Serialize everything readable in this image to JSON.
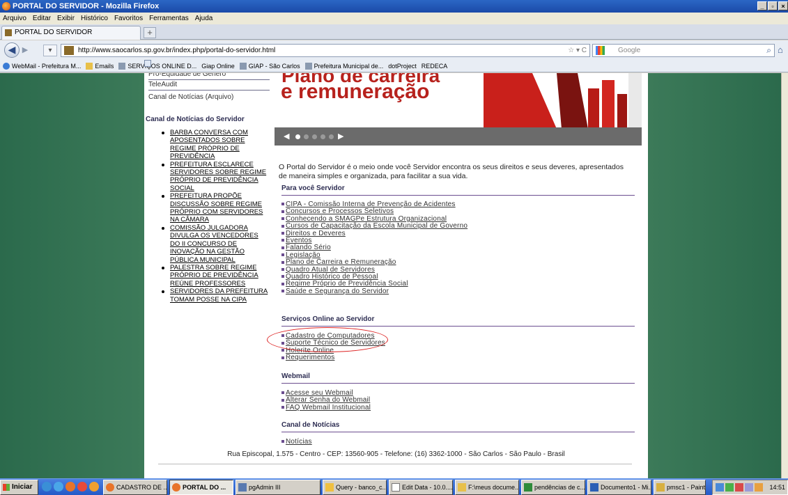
{
  "window": {
    "title": "PORTAL DO SERVIDOR - Mozilla Firefox",
    "min": "_",
    "max": "▫",
    "close": "×"
  },
  "menu": [
    "Arquivo",
    "Editar",
    "Exibir",
    "Histórico",
    "Favoritos",
    "Ferramentas",
    "Ajuda"
  ],
  "tab": {
    "label": "PORTAL DO SERVIDOR",
    "new": "+"
  },
  "nav": {
    "url": "http://www.saocarlos.sp.gov.br/index.php/portal-do-servidor.html",
    "url_ctrls": "☆ ▾ C",
    "search_placeholder": "Google"
  },
  "bookmarks": [
    {
      "label": "WebMail - Prefeitura M...",
      "icon": "globe-icon"
    },
    {
      "label": "Emails",
      "icon": "folder-icon"
    },
    {
      "label": "SERVIÇOS ONLINE D...",
      "icon": "site-icon"
    },
    {
      "label": "Giap Online",
      "icon": "page-icon"
    },
    {
      "label": "GIAP - São Carlos",
      "icon": "site-icon"
    },
    {
      "label": "Prefeitura Municipal de...",
      "icon": "site-icon"
    },
    {
      "label": "dotProject",
      "icon": "page-icon"
    },
    {
      "label": "REDECA",
      "icon": "page-icon"
    }
  ],
  "left": {
    "cut_link": "Pró-Equidade de Gênero",
    "top_links": [
      "TeleAudit",
      "Canal de Notícias (Arquivo)"
    ],
    "news_title": "Canal de Notícias do Servidor",
    "news": [
      "BARBA CONVERSA COM APOSENTADOS SOBRE REGIME PRÓPRIO DE PREVIDÊNCIA",
      "PREFEITURA ESCLARECE SERVIDORES SOBRE REGIME PRÓPRIO DE PREVIDÊNCIA SOCIAL",
      "PREFEITURA PROPÕE DISCUSSÃO SOBRE REGIME PRÓPRIO COM SERVIDORES NA CÂMARA",
      "COMISSÃO JULGADORA DIVULGA OS VENCEDORES DO II CONCURSO DE INOVAÇÃO NA GESTÃO PÚBLICA MUNICIPAL",
      "PALESTRA SOBRE REGIME PRÓPRIO DE PREVIDÊNCIA REÚNE PROFESSORES",
      "SERVIDORES DA PREFEITURA TOMAM POSSE NA CIPA"
    ]
  },
  "banner": {
    "line1": "Plano de carreira",
    "line2": "e remuneração",
    "prev": "◀",
    "next": "▶"
  },
  "intro": "O Portal do Servidor é o meio onde você Servidor encontra os seus direitos e seus deveres, apresentados de maneira simples e organizada, para facilitar a sua vida.",
  "sections": [
    {
      "title": "Para você Servidor",
      "links": [
        "CIPA - Comissão Interna de Prevenção de Acidentes",
        "Concursos e Processos Seletivos",
        "Conhecendo a SMAGPe Estrutura Organizacional",
        "Cursos de Capacitação da Escola Municipal de Governo",
        "Direitos e Deveres",
        "Eventos",
        "Falando Sério",
        "Legislação",
        "Plano de Carreira e Remuneração",
        "Quadro Atual de Servidores",
        "Quadro Histórico de Pessoal",
        "Regime Próprio de Previdência Social",
        "Saúde e Segurança do Servidor"
      ]
    },
    {
      "title": "Serviços Online ao Servidor",
      "links": [
        "Cadastro de Computadores",
        "Suporte Técnico de Servidores",
        "Holerite Online",
        "Requerimentos"
      ]
    },
    {
      "title": "Webmail",
      "links": [
        "Acesse seu Webmail",
        "Alterar Senha do Webmail",
        "FAQ Webmail Institucional"
      ]
    },
    {
      "title": "Canal de Notícias",
      "links": [
        "Notícias"
      ]
    }
  ],
  "footer": "Rua Episcopal, 1.575 - Centro - CEP: 13560-905 - Telefone: (16) 3362-1000 - São Carlos - São Paulo - Brasil",
  "taskbar": {
    "start": "Iniciar",
    "items": [
      {
        "label": "CADASTRO DE ...",
        "active": false,
        "w": 92
      },
      {
        "label": "PORTAL DO ...",
        "active": true,
        "w": 92
      },
      {
        "label": "pgAdmin III",
        "active": false,
        "w": 122
      },
      {
        "label": "Query - banco_c...",
        "active": false,
        "w": 92
      },
      {
        "label": "Edit Data - 10.0....",
        "active": false,
        "w": 92
      },
      {
        "label": "F:\\meus docume...",
        "active": false,
        "w": 92
      },
      {
        "label": "pendências de c...",
        "active": false,
        "w": 92
      },
      {
        "label": "Documento1 - Mi...",
        "active": false,
        "w": 92
      },
      {
        "label": "pmsc1 - Paint",
        "active": false,
        "w": 75
      }
    ],
    "clock": "14:51"
  }
}
